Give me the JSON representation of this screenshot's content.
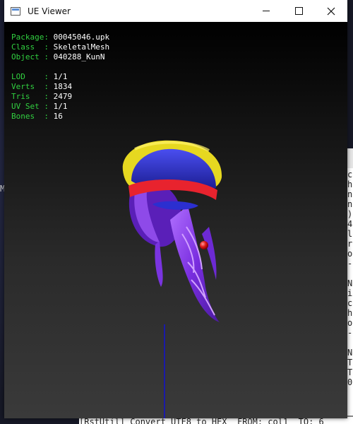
{
  "window": {
    "title": "UE Viewer"
  },
  "info": {
    "package_key": "Package: ",
    "package_value": "00045046.upk",
    "class_key": "Class  : ",
    "class_value": "SkeletalMesh",
    "object_key": "Object : ",
    "object_value": "040288_KunN",
    "lod_key": "LOD    : ",
    "lod_value": "1/1",
    "verts_key": "Verts  : ",
    "verts_value": "1834",
    "tris_key": "Tris   : ",
    "tris_value": "2479",
    "uvset_key": "UV Set : ",
    "uvset_value": "1/1",
    "bones_key": "Bones  : ",
    "bones_value": "16"
  },
  "background": {
    "status_line": "[RstUtil] Convert UTF8 to HEX  FROM: col1  TO: 6",
    "console_column": "c\nh\nn\nn\n)\n4\nl\nr\no\n-\n\nN\ni\nc\nh\no\n-\n\nN\nT\nT\n0",
    "left_letter": "M"
  },
  "colors": {
    "info_key": "#31d040",
    "info_value": "#ffffff",
    "hat_yellow": "#e8dc1c",
    "hat_red": "#e8232e",
    "hat_blue": "#2b2fd0",
    "hair_purple": "#8a3ee8"
  }
}
